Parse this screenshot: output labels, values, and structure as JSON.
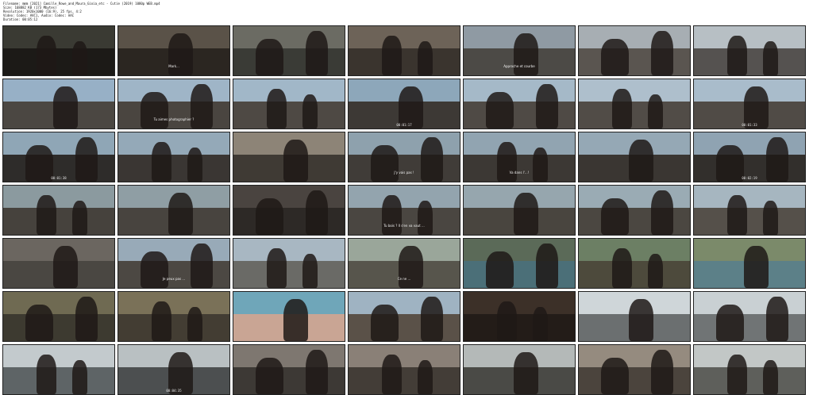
{
  "header": {
    "lines": [
      "Filename: mmm [2021] Camille_Rowe_and_Maura_Gioia_etc - Cutie (2019) 1080p WEB.mp4",
      "Size: 168882 KB (173 Mbytes)",
      "Resolution: 1920x1080 (16:9), 25 fps, 4:2",
      "Video: Codec: AVC1, Audio: Codec: AAC",
      "Duration: 00:05:12"
    ]
  },
  "thumbnails": [
    {
      "ts": "",
      "sub": "",
      "sky": "#3a3a33",
      "ground": "#1c1a17"
    },
    {
      "ts": "",
      "sub": "Mark...",
      "sky": "#5a5248",
      "ground": "#2b2621"
    },
    {
      "ts": "",
      "sub": "",
      "sky": "#6b6b63",
      "ground": "#3a3b36"
    },
    {
      "ts": "",
      "sub": "",
      "sky": "#6d6358",
      "ground": "#3a342e"
    },
    {
      "ts": "",
      "sub": "Approche et courbe",
      "sky": "#8f9aa3",
      "ground": "#4c4a46"
    },
    {
      "ts": "",
      "sub": "",
      "sky": "#a7aeb3",
      "ground": "#5a5550"
    },
    {
      "ts": "",
      "sub": "",
      "sky": "#b7bfc4",
      "ground": "#555250"
    },
    {
      "ts": "",
      "sub": "",
      "sky": "#97b0c6",
      "ground": "#4b4742"
    },
    {
      "ts": "",
      "sub": "Tu aimes photographier ?",
      "sky": "#9fb5c7",
      "ground": "#4a4540"
    },
    {
      "ts": "",
      "sub": "",
      "sky": "#a1b7c8",
      "ground": "#4e4944"
    },
    {
      "ts": "00:01:17",
      "sub": "",
      "sky": "#8da7ba",
      "ground": "#3d3935"
    },
    {
      "ts": "",
      "sub": "",
      "sky": "#a5b9c8",
      "ground": "#4f4a45"
    },
    {
      "ts": "",
      "sub": "",
      "sky": "#aebfcc",
      "ground": "#514c47"
    },
    {
      "ts": "00:01:33",
      "sub": "",
      "sky": "#a9bccb",
      "ground": "#504b46"
    },
    {
      "ts": "00:01:38",
      "sub": "",
      "sky": "#8fa6b6",
      "ground": "#2e2c2a"
    },
    {
      "ts": "",
      "sub": "",
      "sky": "#94a9b8",
      "ground": "#3a3633"
    },
    {
      "ts": "",
      "sub": "",
      "sky": "#8d8477",
      "ground": "#3f3a34"
    },
    {
      "ts": "",
      "sub": "J'y vais pas !",
      "sky": "#8ea1ad",
      "ground": "#403c38"
    },
    {
      "ts": "",
      "sub": "Va dans l'...!",
      "sky": "#91a4b1",
      "ground": "#3c3834"
    },
    {
      "ts": "",
      "sub": "",
      "sky": "#95a8b5",
      "ground": "#3a3632"
    },
    {
      "ts": "00:02:19",
      "sub": "",
      "sky": "#8fa3b2",
      "ground": "#322f2c"
    },
    {
      "ts": "",
      "sub": "",
      "sky": "#8b9a9f",
      "ground": "#46423d"
    },
    {
      "ts": "",
      "sub": "",
      "sky": "#8f9ea4",
      "ground": "#48443f"
    },
    {
      "ts": "",
      "sub": "",
      "sky": "#4a4440",
      "ground": "#2d2926"
    },
    {
      "ts": "",
      "sub": "Tu bois ? Il s'en va vaut ...",
      "sky": "#93a4ae",
      "ground": "#4a4641"
    },
    {
      "ts": "",
      "sub": "",
      "sky": "#96a6ae",
      "ground": "#49453f"
    },
    {
      "ts": "",
      "sub": "",
      "sky": "#9aabb4",
      "ground": "#4b4741"
    },
    {
      "ts": "",
      "sub": "",
      "sky": "#a6b6c0",
      "ground": "#55504a"
    },
    {
      "ts": "",
      "sub": "",
      "sky": "#6b6660",
      "ground": "#4a4742"
    },
    {
      "ts": "",
      "sub": "Je peux pas ...",
      "sky": "#98aab8",
      "ground": "#4c4843"
    },
    {
      "ts": "",
      "sub": "",
      "sky": "#a8b7c2",
      "ground": "#6a6a66"
    },
    {
      "ts": "",
      "sub": "Ce ne ...",
      "sky": "#9aa69a",
      "ground": "#57554c"
    },
    {
      "ts": "",
      "sub": "",
      "sky": "#5b6a58",
      "ground": "#4b6f78"
    },
    {
      "ts": "",
      "sub": "",
      "sky": "#6c7f64",
      "ground": "#4d4a3c"
    },
    {
      "ts": "",
      "sub": "",
      "sky": "#7b8a6a",
      "ground": "#5c8088"
    },
    {
      "ts": "",
      "sub": "",
      "sky": "#6f6a52",
      "ground": "#3d3a30"
    },
    {
      "ts": "",
      "sub": "",
      "sky": "#7a7158",
      "ground": "#433d33"
    },
    {
      "ts": "",
      "sub": "",
      "sky": "#6fa6b9",
      "ground": "#c9a594"
    },
    {
      "ts": "",
      "sub": "",
      "sky": "#9fb3c2",
      "ground": "#5a5148"
    },
    {
      "ts": "",
      "sub": "",
      "sky": "#3c3028",
      "ground": "#231c18"
    },
    {
      "ts": "",
      "sub": "",
      "sky": "#cfd6d9",
      "ground": "#6b6f70"
    },
    {
      "ts": "",
      "sub": "",
      "sky": "#c9d0d3",
      "ground": "#707475"
    },
    {
      "ts": "",
      "sub": "",
      "sky": "#c3cacd",
      "ground": "#5e6466"
    },
    {
      "ts": "00:04:35",
      "sub": "",
      "sky": "#b9c0c2",
      "ground": "#4c4f50"
    },
    {
      "ts": "",
      "sub": "",
      "sky": "#7e7770",
      "ground": "#3d3935"
    },
    {
      "ts": "",
      "sub": "",
      "sky": "#8a8077",
      "ground": "#433d37"
    },
    {
      "ts": "",
      "sub": "",
      "sky": "#b4b9b8",
      "ground": "#4a4a46"
    },
    {
      "ts": "",
      "sub": "",
      "sky": "#958b7f",
      "ground": "#4b443d"
    },
    {
      "ts": "",
      "sub": "",
      "sky": "#c2c7c6",
      "ground": "#5e5f5b"
    }
  ]
}
